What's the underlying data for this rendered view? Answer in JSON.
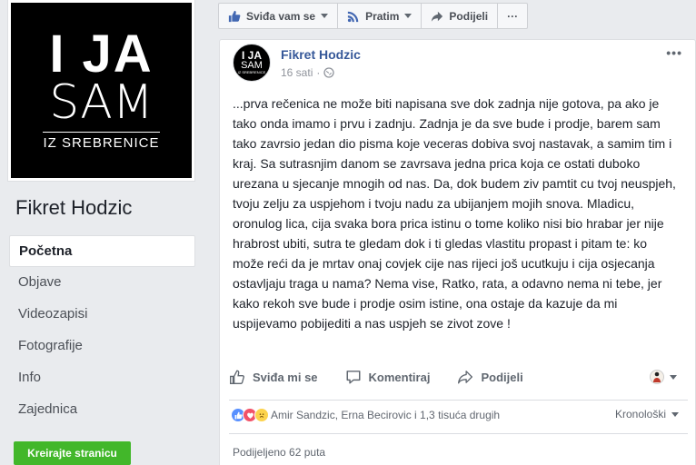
{
  "sidebar": {
    "logo": {
      "line1": "I JA",
      "line2": "SAM",
      "line3": "IZ SREBRENICE"
    },
    "page_name": "Fikret Hodzic",
    "nav": [
      {
        "label": "Početna"
      },
      {
        "label": "Objave"
      },
      {
        "label": "Videozapisi"
      },
      {
        "label": "Fotografije"
      },
      {
        "label": "Info"
      },
      {
        "label": "Zajednica"
      }
    ],
    "create_button": "Kreirajte stranicu"
  },
  "top_actions": {
    "like_label": "Sviđa vam se",
    "follow_label": "Pratim",
    "share_label": "Podijeli",
    "more_label": "···"
  },
  "post": {
    "author": "Fikret Hodzic",
    "time": "16 sati",
    "dot": "·",
    "more": "•••",
    "text": "...prva rečenica ne može biti napisana sve dok zadnja nije gotova, pa ako je tako onda imamo i prvu i zadnju. Zadnja je da sve bude i prodje, barem sam tako zavrsio jedan dio pisma koje veceras dobiva svoj nastavak, a samim tim i kraj. Sa sutrasnjim danom se zavrsava jedna prica koja ce ostati duboko urezana u sjecanje mnogih od nas. Da, dok budem ziv pamtit cu tvoj neuspjeh, tvoju zelju za uspjehom i tvoju nadu za ubijanjem mojih snova. Mladicu, oronulog lica, cija svaka bora prica istinu o tome koliko nisi bio hrabar jer nije hrabrost ubiti, sutra te gledam dok i ti gledas vlastitu propast i pitam te: ko može reći da je mrtav onaj covjek cije nas rijeci još ucutkuju i cija osjecanja ostavljaju traga u nama? Nema vise, Ratko, rata, a odavno nema ni tebe, jer kako rekoh sve bude i prodje osim istine, ona ostaje da kazuje da mi uspijevamo pobijediti a nas uspjeh se zivot zove !",
    "actions": {
      "like": "Sviđa mi se",
      "comment": "Komentiraj",
      "share": "Podijeli"
    },
    "reactions_text": "Amir Sandzic, Erna Becirovic i 1,3 tisuća drugih",
    "sort_label": "Kronološki",
    "shares_text": "Podijeljeno 62 puta"
  },
  "colors": {
    "link": "#365899",
    "green": "#42b72a",
    "like_blue": "#5890ff",
    "love_red": "#f25268"
  }
}
